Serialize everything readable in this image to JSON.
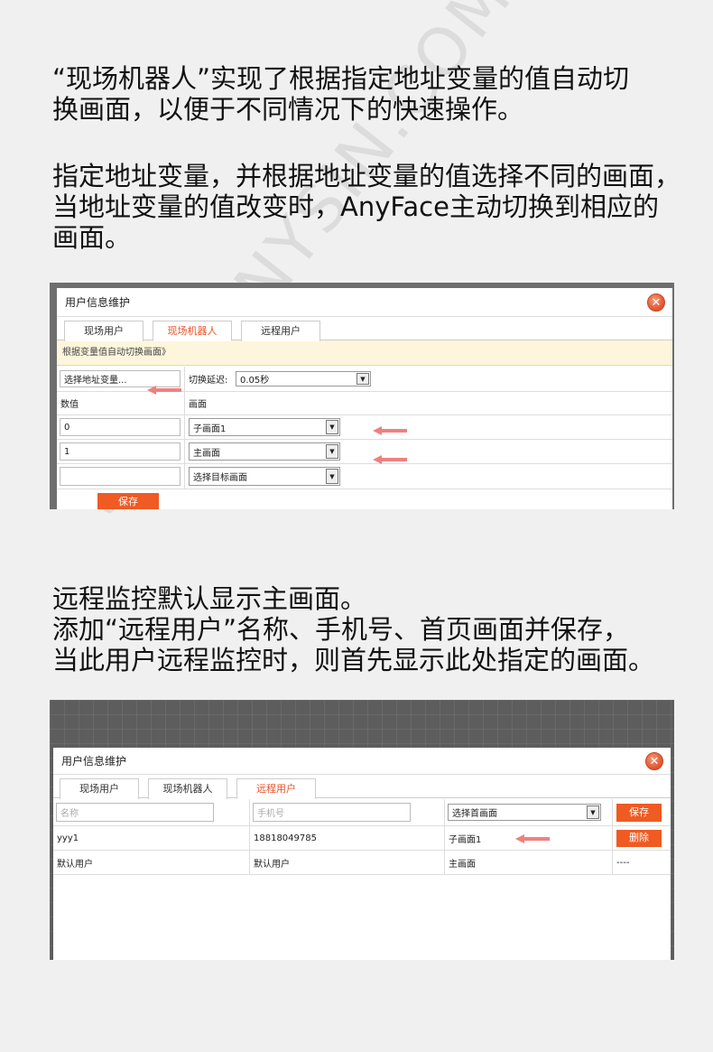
{
  "paragraphs": {
    "p1_line1": "“现场机器人”实现了根据指定地址变量的值自动切",
    "p1_line2": "换画面，以便于不同情况下的快速操作。",
    "p2_line1": "指定地址变量，并根据地址变量的值选择不同的画面，",
    "p2_line2": "当地址变量的值改变时，AnyFace主动切换到相应的",
    "p2_line3": "画面。",
    "p3_line1": "远程监控默认显示主画面。",
    "p3_line2": "添加“远程用户”名称、手机号、首页画面并保存，",
    "p3_line3": "当此用户远程监控时，则首先显示此处指定的画面。"
  },
  "watermark": "WWW.ANYSIN.COM",
  "dialog1": {
    "title": "用户信息维护",
    "tabs": [
      "现场用户",
      "现场机器人",
      "远程用户"
    ],
    "banner": "根据变量值自动切换画面》",
    "select_var_button": "选择地址变量...",
    "delay_label": "切换延迟:",
    "delay_value": "0.05秒",
    "col_value": "数值",
    "col_screen": "画面",
    "rows": [
      {
        "value": "0",
        "screen": "子画面1"
      },
      {
        "value": "1",
        "screen": "主画面"
      },
      {
        "value": "",
        "screen": "选择目标画面"
      }
    ],
    "save_button": "保存"
  },
  "dialog2": {
    "title": "用户信息维护",
    "tabs": [
      "现场用户",
      "现场机器人",
      "远程用户"
    ],
    "name_placeholder": "名称",
    "phone_placeholder": "手机号",
    "home_select": "选择首画面",
    "save_button": "保存",
    "delete_button": "删除",
    "rows": [
      {
        "name": "yyy1",
        "phone": "18818049785",
        "screen": "子画面1",
        "action": "删除"
      },
      {
        "name": "默认用户",
        "phone": "默认用户",
        "screen": "主画面",
        "action": "----"
      }
    ]
  },
  "colors": {
    "accent": "#f05a23",
    "arrow": "#f08080",
    "banner": "#fdf6dc"
  },
  "icons": [
    "close-icon",
    "chevron-down-icon",
    "left-arrow-icon"
  ]
}
